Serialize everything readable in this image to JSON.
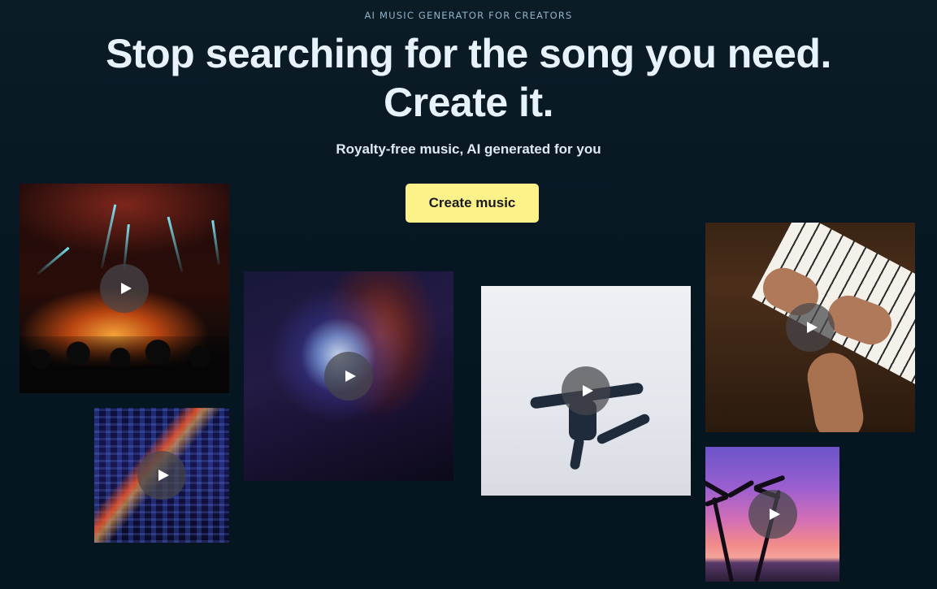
{
  "hero": {
    "eyebrow": "AI MUSIC GENERATOR FOR CREATORS",
    "headline_line1": "Stop searching for the song you need.",
    "headline_line2": "Create it.",
    "subheadline": "Royalty-free music, AI generated for you",
    "cta_label": "Create music"
  },
  "tiles": [
    {
      "id": "concert",
      "icon": "play-icon"
    },
    {
      "id": "city",
      "icon": "play-icon"
    },
    {
      "id": "disco",
      "icon": "play-icon"
    },
    {
      "id": "dancer",
      "icon": "play-icon"
    },
    {
      "id": "piano",
      "icon": "play-icon"
    },
    {
      "id": "palm",
      "icon": "play-icon"
    }
  ],
  "colors": {
    "background": "#071722",
    "cta_background": "#fdf28a",
    "headline": "#e8f2fc"
  }
}
